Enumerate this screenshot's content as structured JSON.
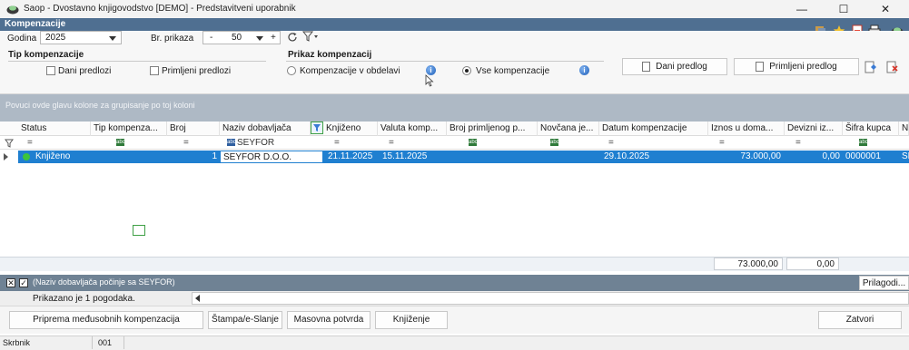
{
  "window": {
    "title": "Saop - Dvostavno knjigovodstvo [DEMO] - Predstavitveni uporabnik",
    "minimize": "—",
    "maximize": "☐",
    "close": "✕"
  },
  "module": {
    "title": "Kompenzacije"
  },
  "filters": {
    "year_label": "Godina",
    "year_value": "2025",
    "order_label": "Br. prikaza",
    "order_minus": "-",
    "order_value": "50",
    "order_plus": "+",
    "refresh_icon": "refresh-icon",
    "filter_icon": "filter-icon"
  },
  "type_group": {
    "title": "Tip kompenzacije",
    "option_given": "Dani predlozi",
    "option_received": "Primljeni predlozi"
  },
  "display_group": {
    "title": "Prikaz kompenzacij",
    "option_in_progress": "Kompenzacije v obdelavi",
    "option_all": "Vse kompenzacije",
    "selected": "Vse kompenzacije"
  },
  "buttons": {
    "given_proposal": "Dani predlog",
    "received_proposal": "Primljeni predlog"
  },
  "grid": {
    "group_hint": "Povuci ovde glavu kolone za grupisanje po toj koloni",
    "columns": [
      "Status",
      "Tip kompenza...",
      "Broj",
      "Naziv dobavljača",
      "Knjiženo",
      "Valuta komp...",
      "Broj primljenog p...",
      "Novčana je...",
      "Datum kompenzacije",
      "Iznos u doma...",
      "Devizni iz...",
      "Šifra kupca",
      "N"
    ],
    "filter_eq": "=",
    "filter_abc": "abc",
    "filter_supplier": "SEYFOR",
    "row": {
      "status": "Knjiženo",
      "broj": "1",
      "supplier": "SEYFOR D.O.O.",
      "booked": "21.11.2025",
      "currency_date": "15.11.2025",
      "comp_date": "29.10.2025",
      "amount_domestic": "73.000,00",
      "amount_foreign": "0,00",
      "customer_code": "0000001",
      "last": "SE"
    },
    "totals": {
      "amount_domestic": "73.000,00",
      "amount_foreign": "0,00"
    }
  },
  "filter_status": {
    "text": "(Naziv dobavljača počinje sa SEYFOR)",
    "customize": "Prilagodi..."
  },
  "count": {
    "text": "Prikazano je 1 pogodaka."
  },
  "actions": {
    "prepare": "Priprema međusobnih kompenzacija",
    "print": "Štampa/e-Slanje",
    "mass_confirm": "Masovna potvrda",
    "booking": "Knjiženje",
    "close": "Zatvori"
  },
  "status_bar": {
    "user_label": "Skrbnik",
    "user_value": "001"
  },
  "colors": {
    "module_bar": "#4f6f91",
    "selected_row": "#1f7fd0",
    "status_dot": "#3cc43c"
  }
}
